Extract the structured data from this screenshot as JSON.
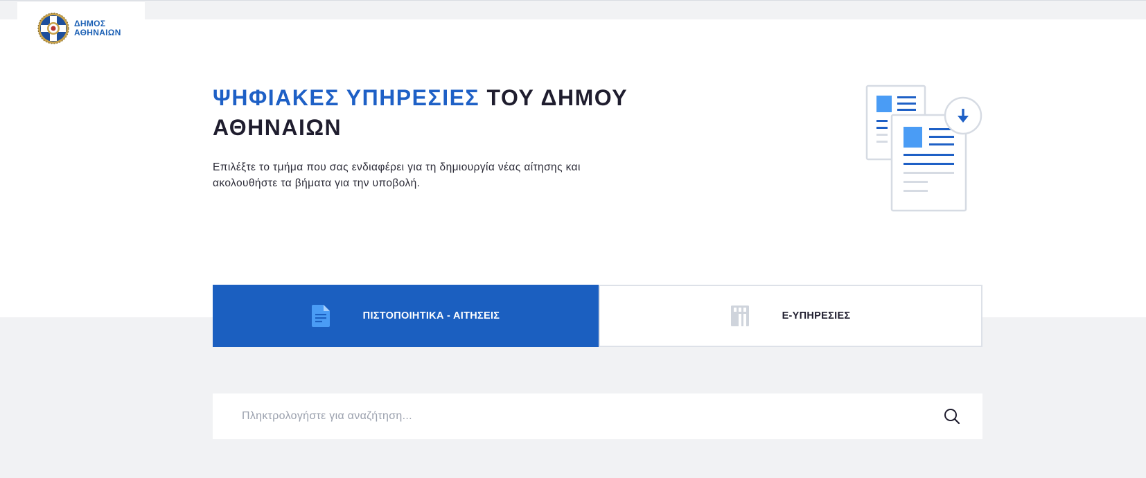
{
  "header": {
    "logo_line1": "ΔΗΜΟΣ",
    "logo_line2": "ΑΘΗΝΑΙΩΝ"
  },
  "hero": {
    "title_accent": "ΨΗΦΙΑΚΕΣ ΥΠΗΡΕΣΙΕΣ",
    "title_rest": "ΤΟΥ ΔΗΜΟΥ ΑΘΗΝΑΙΩΝ",
    "subtitle": "Επιλέξτε το τμήμα που σας ενδιαφέρει για τη δημιουργία νέας αίτησης και ακολουθήστε τα βήματα για την υποβολή."
  },
  "tabs": [
    {
      "label": "ΠΙΣΤΟΠΟΙΗΤΙΚΑ - ΑΙΤΗΣΕΙΣ",
      "icon": "document-icon",
      "active": true
    },
    {
      "label": "Ε-ΥΠΗΡΕΣΙΕΣ",
      "icon": "building-icon",
      "active": false
    }
  ],
  "search": {
    "placeholder": "Πληκτρολογήστε για αναζήτηση...",
    "value": "",
    "icon": "search-icon"
  },
  "colors": {
    "accent": "#1e60c6",
    "active_tab": "#1b5fc0",
    "dark_text": "#1f1d2e",
    "page_bg": "#f1f2f4"
  }
}
